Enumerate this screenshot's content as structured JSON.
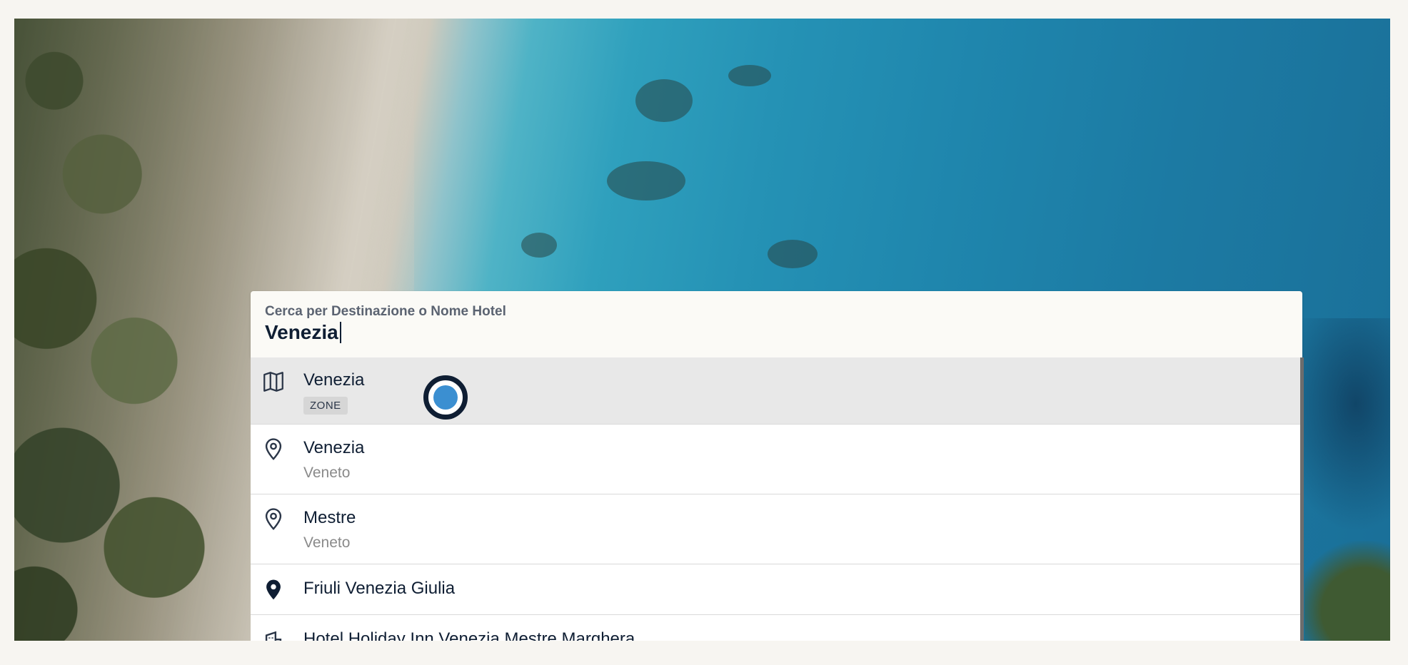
{
  "search": {
    "label": "Cerca per Destinazione o Nome Hotel",
    "value": "Venezia"
  },
  "suggestions": [
    {
      "title": "Venezia",
      "badge": "ZONE",
      "icon": "map-icon",
      "highlighted": true
    },
    {
      "title": "Venezia",
      "subtitle": "Veneto",
      "icon": "location-pin-outline-icon"
    },
    {
      "title": "Mestre",
      "subtitle": "Veneto",
      "icon": "location-pin-outline-icon"
    },
    {
      "title": "Friuli Venezia Giulia",
      "icon": "location-pin-filled-icon"
    },
    {
      "title": "Hotel Holiday Inn Venezia Mestre Marghera",
      "icon": "hotel-building-icon"
    }
  ],
  "colors": {
    "text_primary": "#0f1e33",
    "highlight_row": "#e8e8e8",
    "cursor_blue": "#3b8fd1"
  }
}
